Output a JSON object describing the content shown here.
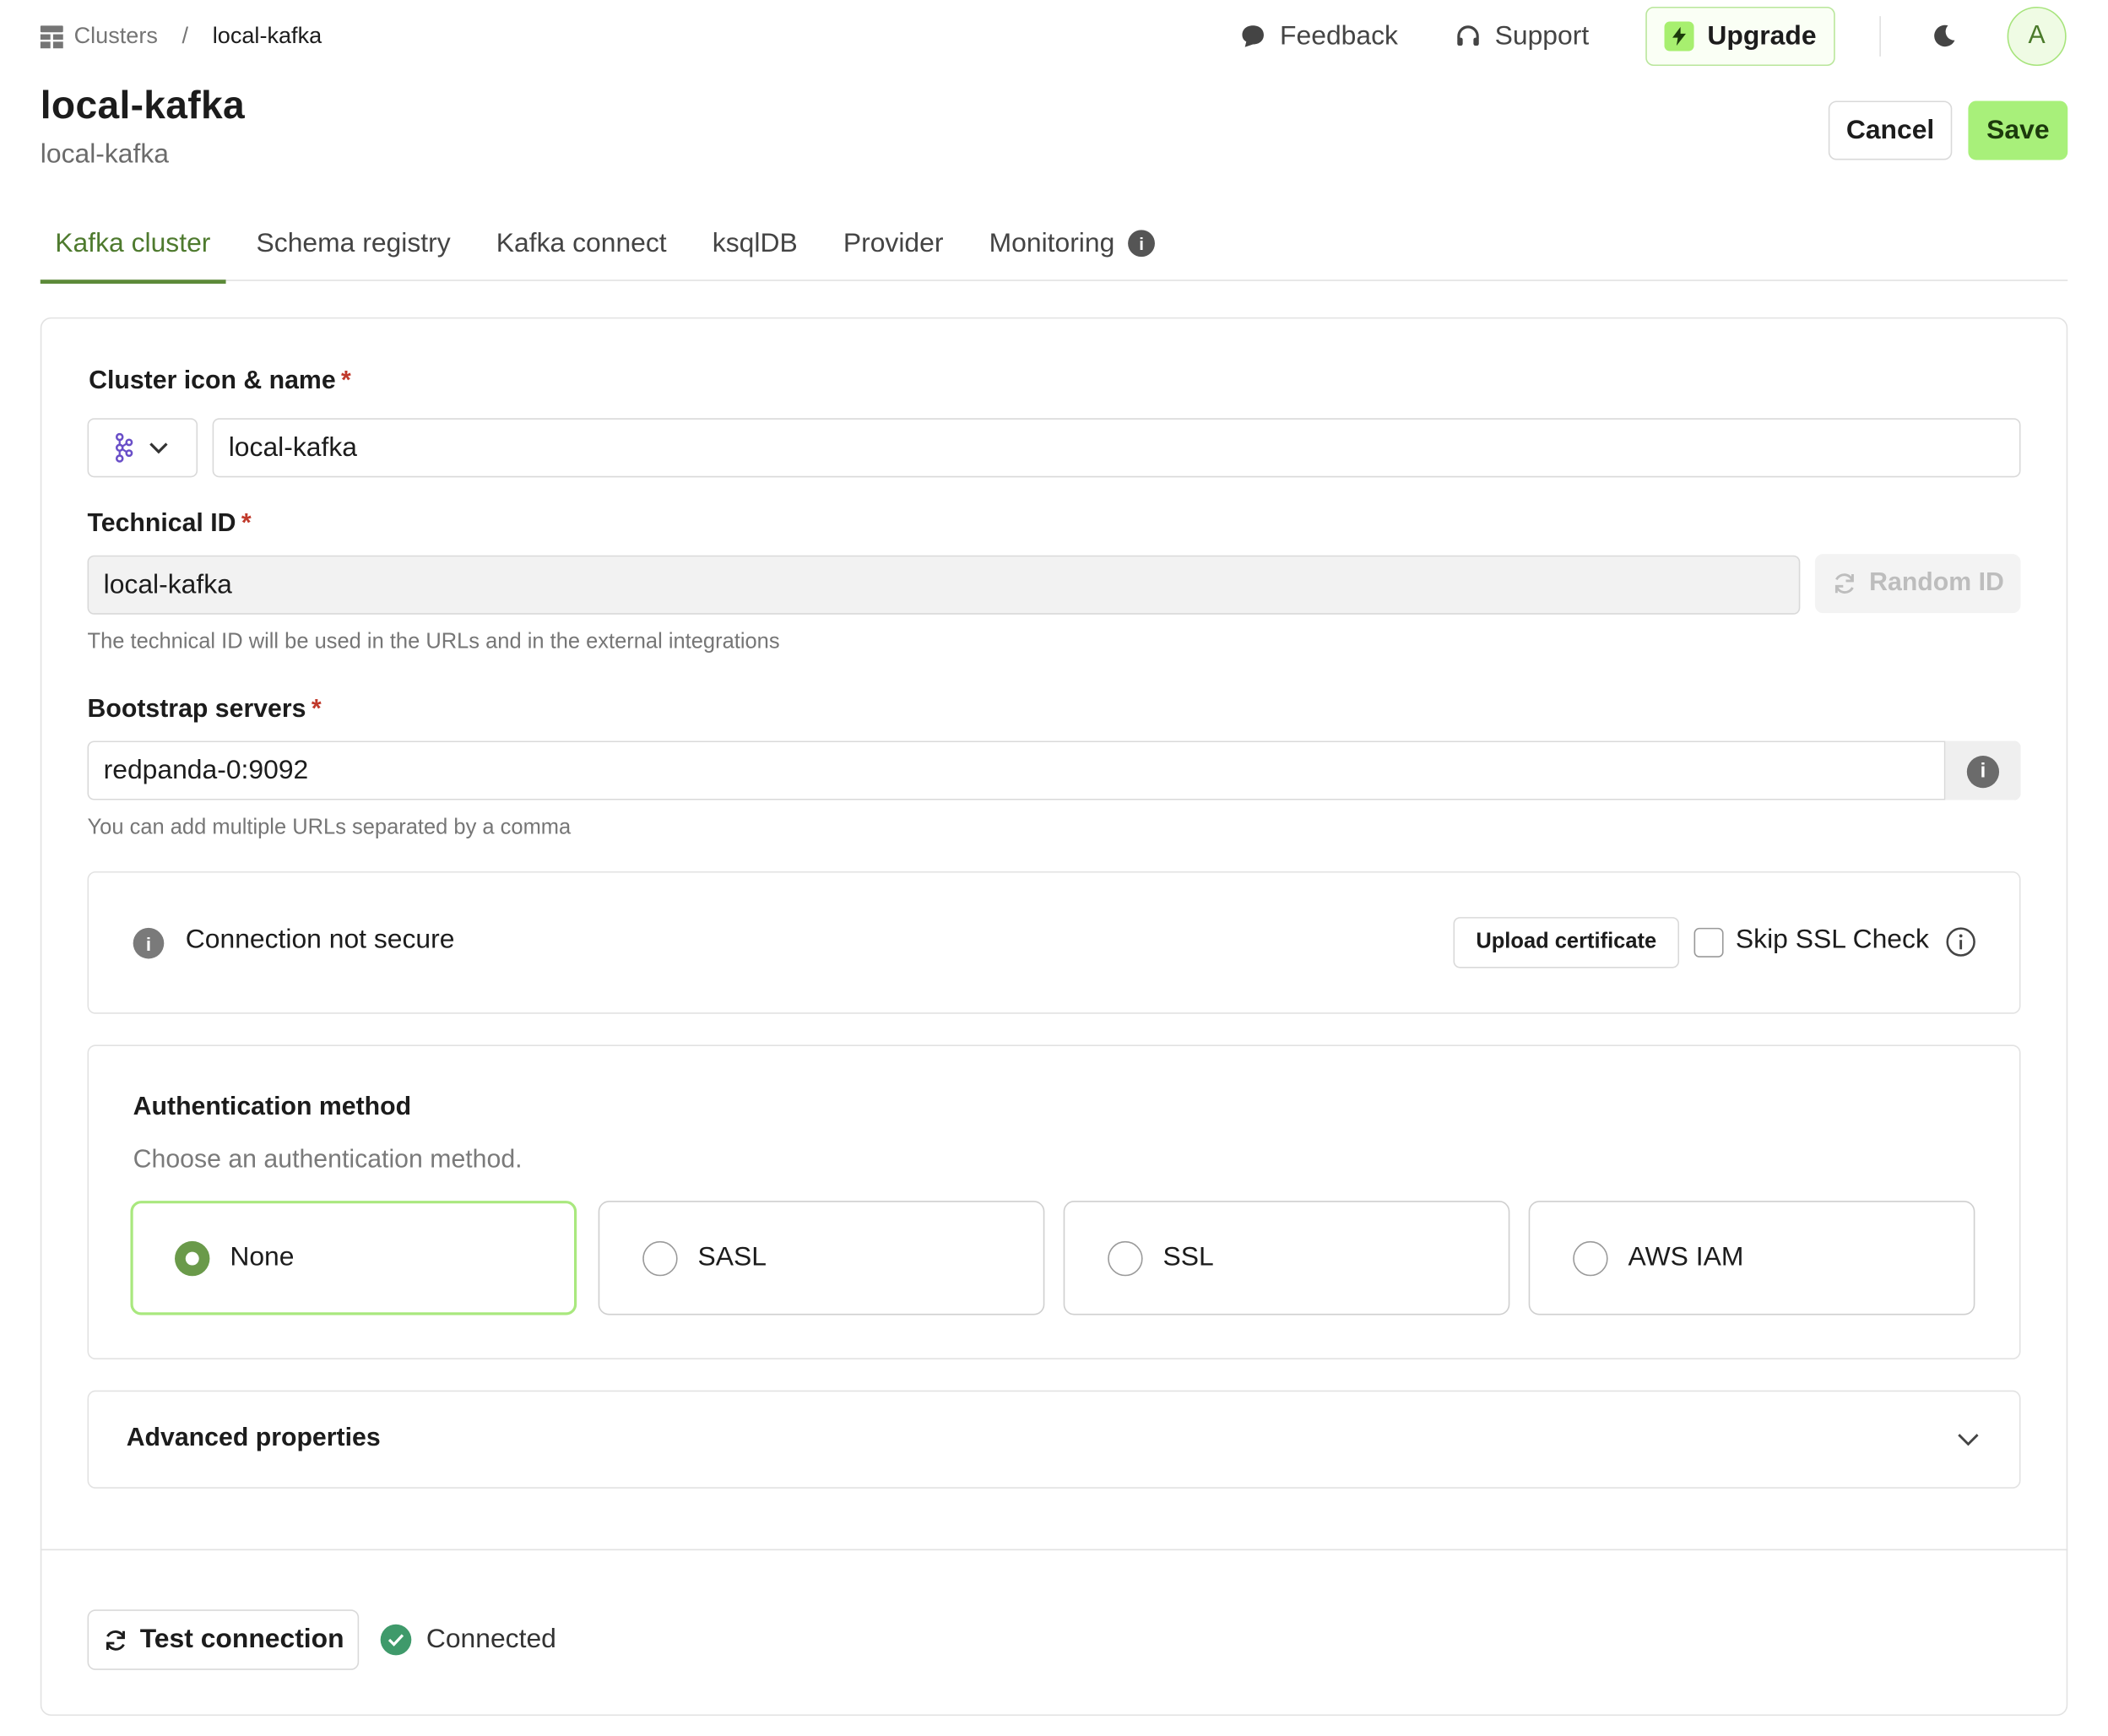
{
  "breadcrumb": {
    "root": "Clusters",
    "separator": "/",
    "current": "local-kafka"
  },
  "topnav": {
    "feedback": "Feedback",
    "support": "Support",
    "upgrade": "Upgrade",
    "avatar_initial": "A"
  },
  "header": {
    "title": "local-kafka",
    "subtitle": "local-kafka",
    "cancel": "Cancel",
    "save": "Save"
  },
  "tabs": [
    {
      "label": "Kafka cluster",
      "active": true
    },
    {
      "label": "Schema registry"
    },
    {
      "label": "Kafka connect"
    },
    {
      "label": "ksqlDB"
    },
    {
      "label": "Provider"
    },
    {
      "label": "Monitoring"
    }
  ],
  "form": {
    "cluster_name": {
      "label": "Cluster icon & name",
      "required": "*",
      "value": "local-kafka"
    },
    "technical_id": {
      "label": "Technical ID",
      "required": "*",
      "value": "local-kafka",
      "random_button": "Random ID",
      "hint": "The technical ID will be used in the URLs and in the external integrations"
    },
    "bootstrap": {
      "label": "Bootstrap servers",
      "required": "*",
      "value": "redpanda-0:9092",
      "hint": "You can add multiple URLs separated by a comma"
    },
    "security": {
      "message": "Connection not secure",
      "upload_button": "Upload certificate",
      "skip_ssl_label": "Skip SSL Check"
    },
    "auth": {
      "title": "Authentication method",
      "description": "Choose an authentication method.",
      "options": [
        {
          "label": "None",
          "selected": true
        },
        {
          "label": "SASL"
        },
        {
          "label": "SSL"
        },
        {
          "label": "AWS IAM"
        }
      ]
    },
    "advanced": {
      "label": "Advanced properties"
    }
  },
  "footer": {
    "test_button": "Test connection",
    "status": "Connected"
  },
  "colors": {
    "accent_green": "#a8f07a",
    "tab_active": "#4e7a2e",
    "success": "#3f9a6b"
  }
}
